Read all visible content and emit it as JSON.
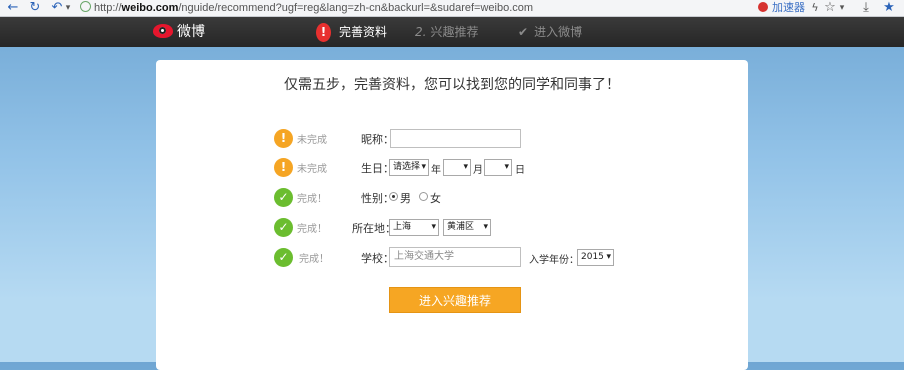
{
  "browser": {
    "url_prefix": "http://",
    "url_host": "weibo.com",
    "url_rest": "/nguide/recommend?ugf=reg&lang=zh-cn&backurl=&sudaref=weibo.com",
    "accelerator": "加速器",
    "icons": [
      "back-icon",
      "refresh-icon",
      "undo-icon",
      "lock-icon",
      "bolt-icon",
      "star-icon",
      "download-icon",
      "bookmark-icon"
    ]
  },
  "nav": {
    "logo_text": "微博",
    "steps": [
      {
        "marker": "!",
        "label": "完善资料",
        "state": "active"
      },
      {
        "marker": "2.",
        "label": "兴趣推荐",
        "state": "pending"
      },
      {
        "marker": "✔",
        "label": "进入微博",
        "state": "pending"
      }
    ]
  },
  "card": {
    "title": "仅需五步，完善资料，您可以找到您的同学和同事了！",
    "rows": {
      "nickname": {
        "status": "未完成",
        "label": "昵称：",
        "value": ""
      },
      "birthday": {
        "status": "未完成",
        "label": "生日：",
        "year_value": "请选择",
        "year_unit": "年",
        "month_value": "",
        "month_unit": "月",
        "day_value": "",
        "day_unit": "日"
      },
      "gender": {
        "status": "完成！",
        "label": "性别：",
        "options": [
          "男",
          "女"
        ],
        "selected": "男"
      },
      "location": {
        "status": "完成！",
        "label": "所在地：",
        "province": "上海",
        "district": "黄浦区"
      },
      "school": {
        "status": "完成！",
        "label": "学校：",
        "value": "上海交通大学",
        "year_label": "入学年份：",
        "year_value": "2015"
      }
    },
    "submit_label": "进入兴趣推荐"
  },
  "colors": {
    "accent_orange": "#f6a623",
    "warn": "#f5a524",
    "ok": "#6bbd2f",
    "weibo_red": "#e6162d"
  }
}
